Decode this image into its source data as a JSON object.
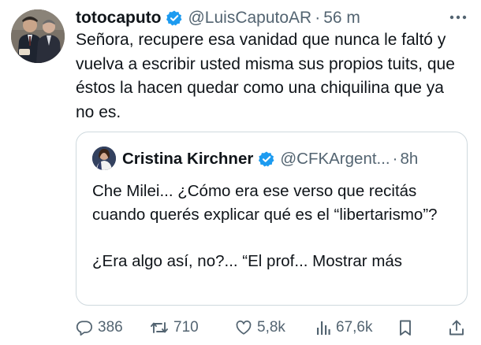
{
  "tweet": {
    "display_name": "totocaputo",
    "handle": "@LuisCaputoAR",
    "separator": "·",
    "time": "56 m",
    "text": "Señora, recupere esa vanidad que nunca le faltó y vuelva a escribir usted misma sus propios tuits, que éstos la hacen quedar como una chiquilina que ya no es.",
    "verified_icon": "verified-badge-icon",
    "more_icon": "more-icon"
  },
  "quote": {
    "display_name": "Cristina Kirchner",
    "handle": "@CFKArgent...",
    "separator": "·",
    "time": "8h",
    "line1": "Che Milei... ¿Cómo era ese verso que recitás cuando querés explicar qué es el “libertarismo”?",
    "line2": "¿Era algo así, no?... “El prof... ",
    "show_more": "Mostrar más"
  },
  "actions": {
    "replies": "386",
    "retweets": "710",
    "likes": "5,8k",
    "views": "67,6k",
    "icons": [
      "reply-icon",
      "retweet-icon",
      "like-icon",
      "views-icon",
      "bookmark-icon",
      "share-icon"
    ]
  },
  "colors": {
    "text": "#0f1419",
    "secondary": "#536471",
    "verified": "#1d9bf0",
    "border": "#cfd9de"
  }
}
